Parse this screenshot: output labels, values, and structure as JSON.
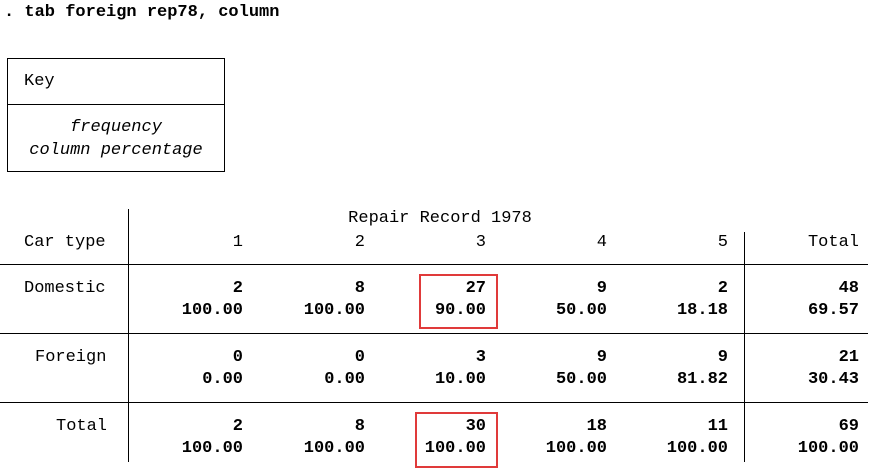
{
  "command": ". tab foreign rep78, column",
  "key": {
    "title": "Key",
    "line1": "frequency",
    "line2": "column percentage"
  },
  "table": {
    "row_var_label": "Car type",
    "col_var_label": "Repair Record 1978",
    "col_headers": [
      "1",
      "2",
      "3",
      "4",
      "5"
    ],
    "total_header": "Total",
    "rows": [
      {
        "label": "Domestic",
        "freq": [
          "2",
          "8",
          "27",
          "9",
          "2"
        ],
        "pct": [
          "100.00",
          "100.00",
          "90.00",
          "50.00",
          "18.18"
        ],
        "total_freq": "48",
        "total_pct": "69.57"
      },
      {
        "label": "Foreign",
        "freq": [
          "0",
          "0",
          "3",
          "9",
          "9"
        ],
        "pct": [
          "0.00",
          "0.00",
          "10.00",
          "50.00",
          "81.82"
        ],
        "total_freq": "21",
        "total_pct": "30.43"
      },
      {
        "label": "Total",
        "freq": [
          "2",
          "8",
          "30",
          "18",
          "11"
        ],
        "pct": [
          "100.00",
          "100.00",
          "100.00",
          "100.00",
          "100.00"
        ],
        "total_freq": "69",
        "total_pct": "100.00"
      }
    ]
  },
  "highlight_color": "#e03a3a"
}
